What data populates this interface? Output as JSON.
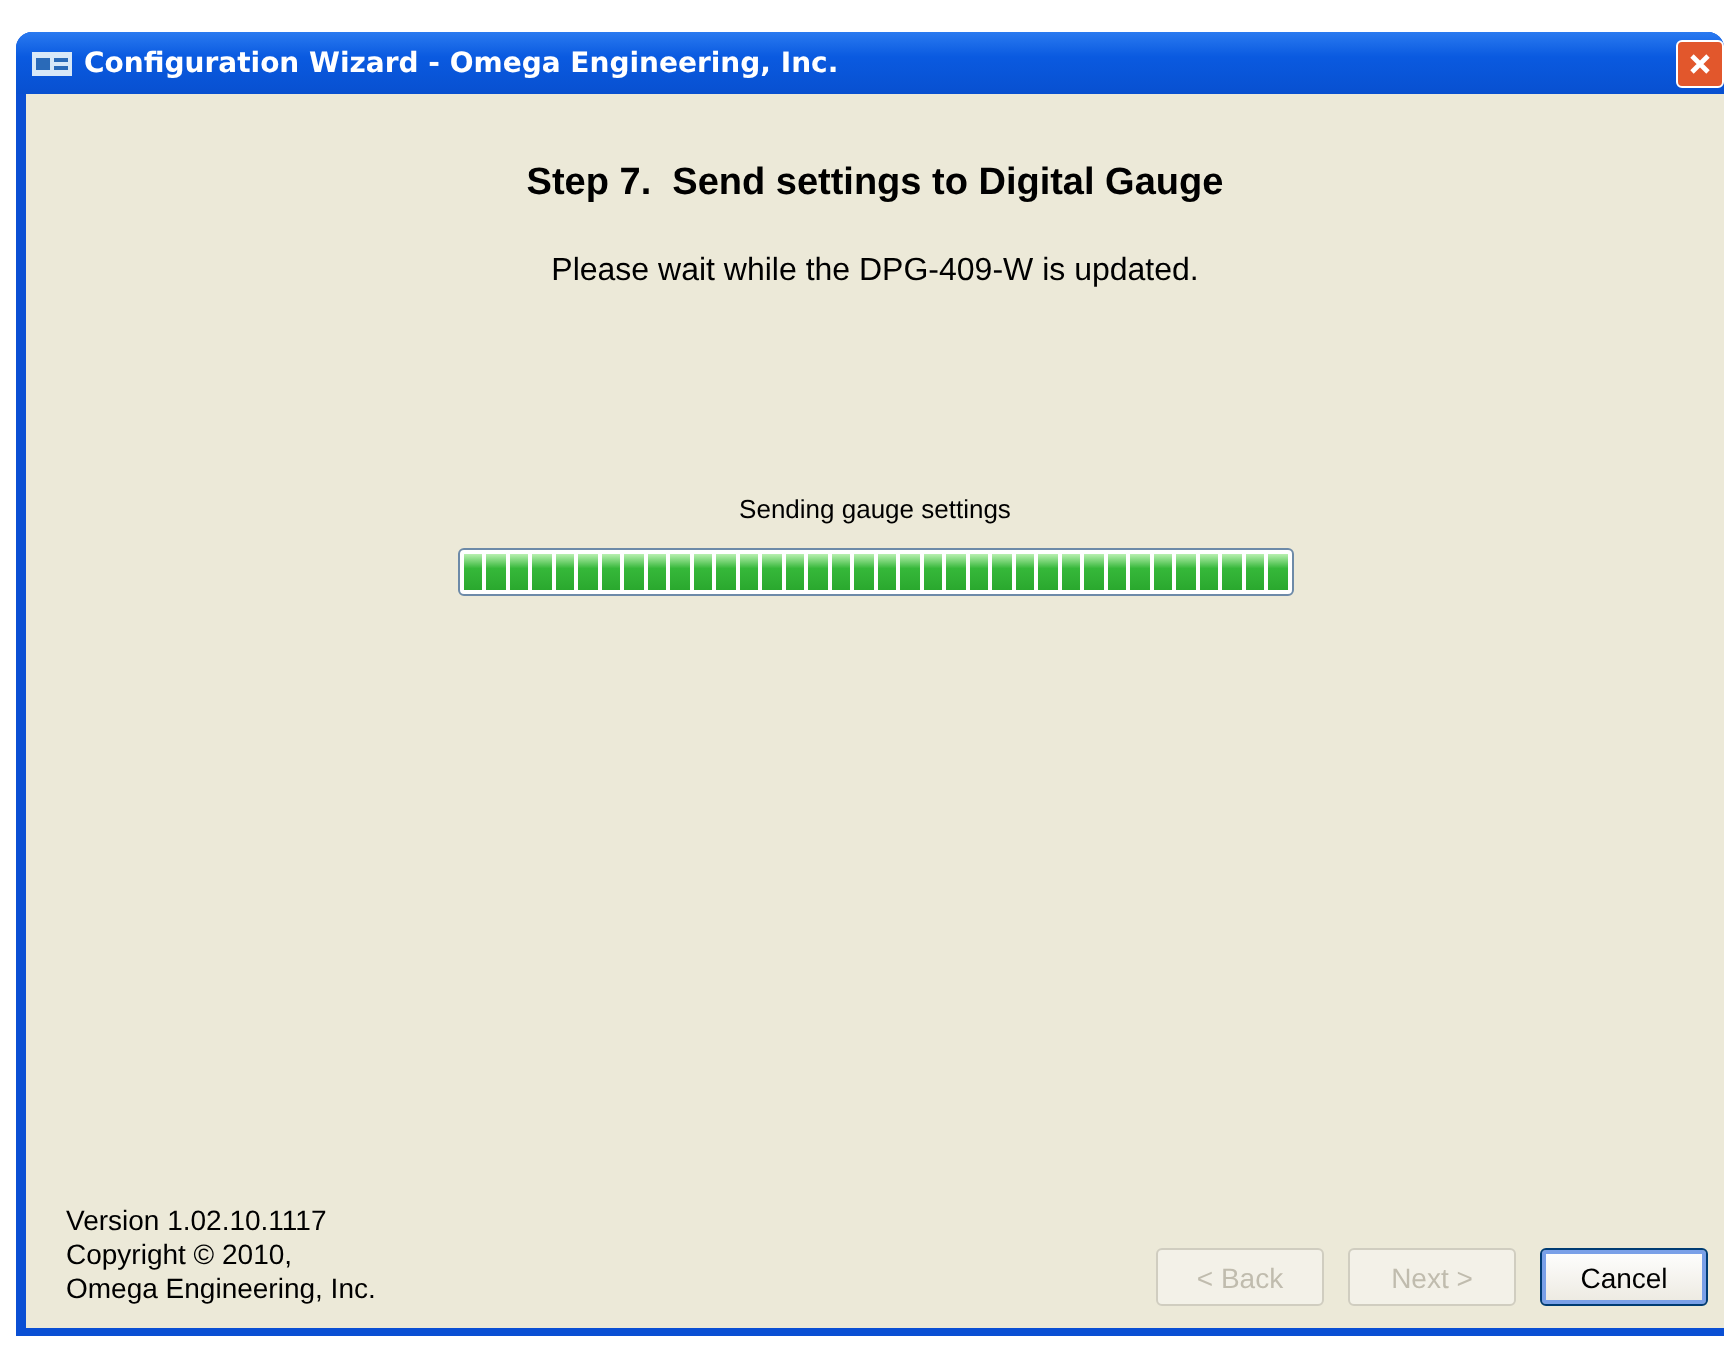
{
  "window": {
    "title": "Configuration Wizard - Omega Engineering, Inc."
  },
  "heading": "Step 7.  Send settings to Digital Gauge",
  "message": "Please wait while the DPG-409-W is updated.",
  "progress": {
    "label": "Sending gauge settings",
    "level": 1
  },
  "footer": {
    "lines": [
      "Version 1.02.10.1117",
      "Copyright © 2010,",
      "Omega Engineering, Inc."
    ]
  },
  "buttons": [
    {
      "label": "< Back",
      "disabled": true,
      "default": false
    },
    {
      "label": "Next >",
      "disabled": true,
      "default": false
    },
    {
      "label": "Cancel",
      "disabled": false,
      "default": true
    }
  ]
}
